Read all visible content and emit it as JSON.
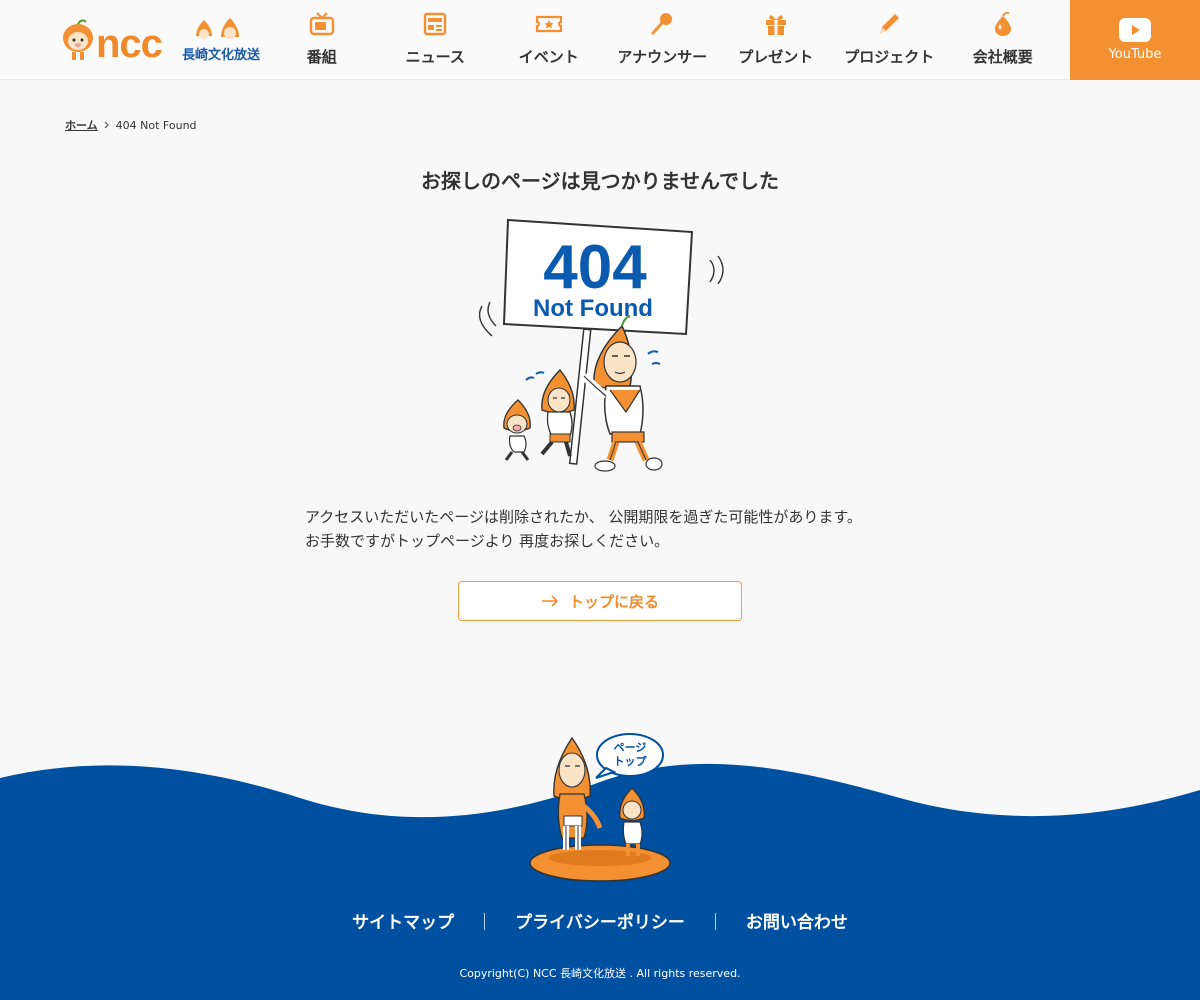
{
  "header": {
    "logo_text": "ncc",
    "logo_sub": "長崎文化放送",
    "nav": [
      {
        "label": "番組",
        "icon": "tv-icon"
      },
      {
        "label": "ニュース",
        "icon": "news-icon"
      },
      {
        "label": "イベント",
        "icon": "ticket-icon"
      },
      {
        "label": "アナウンサー",
        "icon": "microphone-icon"
      },
      {
        "label": "プレゼント",
        "icon": "gift-icon"
      },
      {
        "label": "プロジェクト",
        "icon": "pencil-icon"
      },
      {
        "label": "会社概要",
        "icon": "loquat-icon"
      }
    ],
    "youtube_label": "YouTube"
  },
  "breadcrumb": {
    "home": "ホーム",
    "current": "404 Not Found"
  },
  "main": {
    "title": "お探しのページは見つかりませんでした",
    "sign_code": "404",
    "sign_text": "Not Found",
    "message_line1": "アクセスいただいたページは削除されたか、 公開期限を過ぎた可能性があります。",
    "message_line2": "お手数ですがトップページより 再度お探しください。",
    "back_button": "トップに戻る"
  },
  "footer": {
    "pagetop_line1": "ページ",
    "pagetop_line2": "トップ",
    "links": [
      "サイトマップ",
      "プライバシーポリシー",
      "お問い合わせ"
    ],
    "separator": "｜",
    "copyright": "Copyright(C) NCC 長崎文化放送 . All rights reserved."
  },
  "colors": {
    "accent": "#f39132",
    "brand_blue": "#0050a2",
    "background": "#f8f8f8"
  }
}
